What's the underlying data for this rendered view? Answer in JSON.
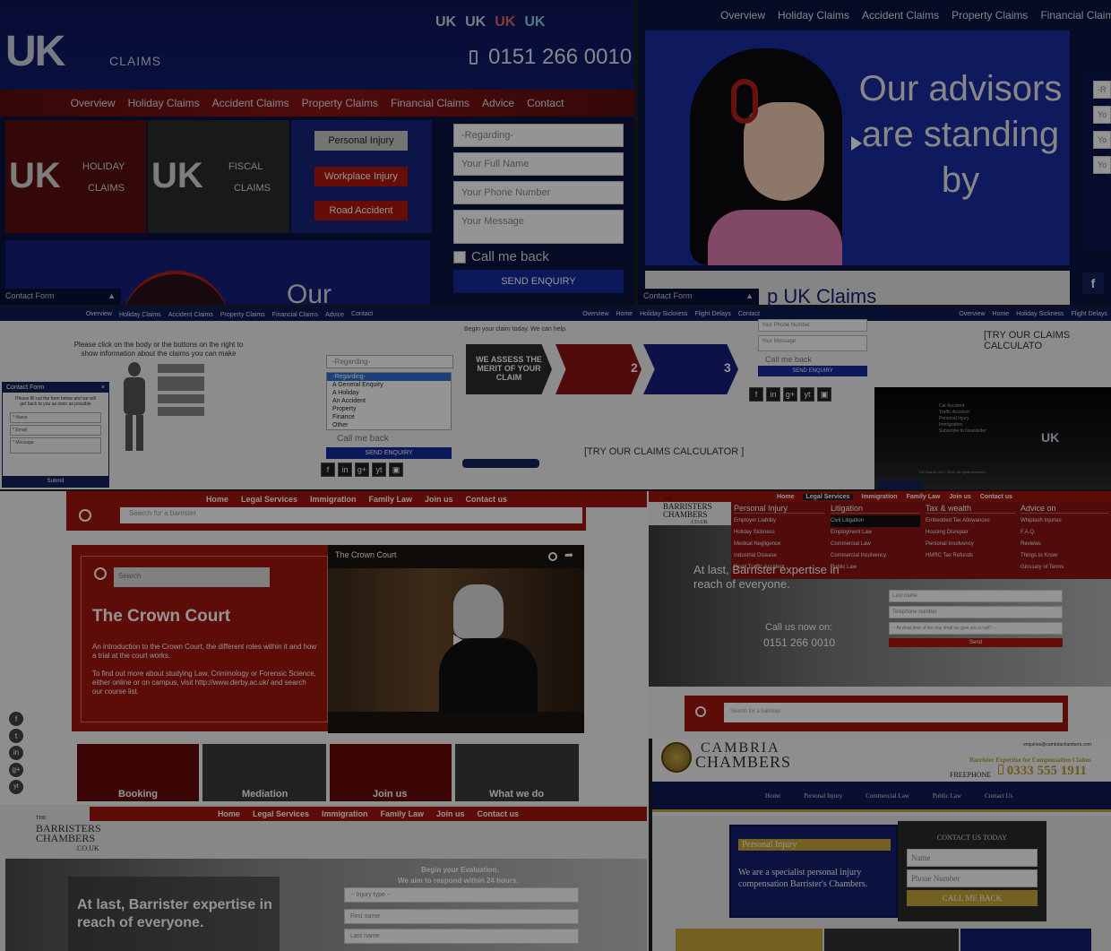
{
  "uk1": {
    "logo_main": "UK",
    "logo_sub": "CLAIMS",
    "strip": [
      "UK",
      "UK",
      "UK",
      "UK"
    ],
    "phone": "0151 266 0010",
    "nav": [
      "Overview",
      "Holiday Claims",
      "Accident Claims",
      "Property Claims",
      "Financial Claims",
      "Advice",
      "Contact"
    ],
    "tile_holiday_sub": "HOLIDAY",
    "tile_fiscal_sub": "FISCAL",
    "buttons": [
      "Personal Injury",
      "Workplace Injury",
      "Road Accident"
    ],
    "form": {
      "regarding": "-Regarding-",
      "name": "Your Full Name",
      "phone": "Your Phone Number",
      "message": "Your Message",
      "callback": "Call me back",
      "send": "SEND ENQUIRY"
    },
    "contact_form": "Contact Form",
    "peek_text": "Our"
  },
  "uk2": {
    "nav": [
      "Overview",
      "Holiday Claims",
      "Accident Claims",
      "Property Claims",
      "Financial Claims"
    ],
    "hero_text": "Our advisors are standing by",
    "contact_form": "Contact Form",
    "welcome": "p UK Claims",
    "side_inputs": [
      "-R",
      "Yo",
      "Yo",
      "Yo"
    ]
  },
  "row2": {
    "nav": [
      "Overview",
      "Holiday Claims",
      "Accident Claims",
      "Property Claims",
      "Financial Claims",
      "Advice",
      "Contact"
    ],
    "body_text": "Please click on the body or the buttons on the right to show information about the claims you can make",
    "contact_form": "Contact Form",
    "cf_text": "Please fill out the form below and we will get back to you as soon as possible",
    "cf_fields": [
      "* Name",
      "* Email",
      "* Message"
    ],
    "cf_submit": "Submit",
    "dropdown_head": "-Regarding-",
    "dropdown_options": [
      "-Regarding-",
      "A General Enquiry",
      "A Holiday",
      "An Accident",
      "Property",
      "Finance",
      "Other"
    ],
    "callback": "Call me back",
    "send": "SEND ENQUIRY",
    "nav3": [
      "Overview",
      "Home",
      "Holiday Sickness",
      "Flight Delays",
      "Contact"
    ],
    "begin": "Begin your claim today. We can help.",
    "steps": [
      "WE ASSESS THE MERIT OF YOUR CLAIM",
      "2",
      "3"
    ],
    "mini_inputs": [
      "Your Phone Number",
      "Your Message"
    ],
    "calc": "[TRY OUR CLAIMS CALCULATOR ]",
    "nav4": [
      "Overview",
      "Home",
      "Holiday Sickness",
      "Flight Delays"
    ],
    "calc2": "[TRY OUR CLAIMS CALCULATO",
    "list4": [
      "Car Accident",
      "Traffic Accident",
      "Personal Injury",
      "Immigration",
      "Subscribe to Newsletter"
    ],
    "footer4": "UK Claims Ltd © 2016. All rights reserved."
  },
  "barr1": {
    "nav": [
      "Home",
      "Legal Services",
      "Immigration",
      "Family Law",
      "Join us",
      "Contact us"
    ],
    "search_top": "Search for a barrister",
    "search": "Search",
    "title": "The Crown Court",
    "p1": "An introduction to the Crown Court, the different roles within it and how a trial at the court works.",
    "p2": "To find out more about studying Law, Criminology or Forensic Science, either online or on campus, visit http://www.derby.ac.uk/ and search our course list.",
    "video_title": "The Crown Court",
    "tiles": [
      "Booking",
      "Mediation",
      "Join us",
      "What we do"
    ]
  },
  "barr2": {
    "nav": [
      "Home",
      "Legal Services",
      "Immigration",
      "Family Law",
      "Join us",
      "Contact us"
    ],
    "logo": [
      "THE",
      "BARRISTERS",
      "CHAMBERS",
      ".CO.UK"
    ],
    "cols": [
      {
        "head": "Personal Injury",
        "items": [
          "Employer Liability",
          "Holiday Sickness",
          "Medical Negligence",
          "Industrial Disease",
          "Road Traffic Accident"
        ]
      },
      {
        "head": "Litigation",
        "items": [
          "Civil Litigation",
          "Employment Law",
          "Commercial Law",
          "Commercial Insolvency",
          "Public Law"
        ]
      },
      {
        "head": "Tax & wealth",
        "items": [
          "Embedded Tax Allowances",
          "Housing Disrepair",
          "Personal Insolvency",
          "HMRC Tax Refunds"
        ]
      },
      {
        "head": "Advice on",
        "items": [
          "Whiplash Injuries",
          "F.A.Q.",
          "Reviews",
          "Things to Know",
          "Glossary of Terms"
        ]
      }
    ],
    "hero": "At last, Barrister expertise in reach of everyone.",
    "call": "Call us now on:",
    "phone": "0151 266 0010",
    "fields": [
      "Last name",
      "Telephone number",
      "-- At what time of the day shall we give you a call? --"
    ],
    "send": "Send",
    "search": "Search for a barrister"
  },
  "cambria": {
    "name1": "CAMBRIA",
    "name2": "CHAMBERS",
    "email": "enquiries@cambriachambers.com",
    "tagline": "Barrister Expertise for Compensation Claims",
    "freephone": "FREEPHONE",
    "phone": "0333 555 1911",
    "nav": [
      "Home",
      "Personal Injury",
      "Commercial Law",
      "Public Law",
      "Contact Us"
    ],
    "pi_title": "Personal Injury",
    "pi_text": "We are a specialist personal injury compensation Barrister's Chambers.",
    "contact_title": "CONTACT US TODAY",
    "inputs": [
      "Name",
      "Phone Number"
    ],
    "callback": "CALL ME BACK"
  },
  "barr3": {
    "nav": [
      "Home",
      "Legal Services",
      "Immigration",
      "Family Law",
      "Join us",
      "Contact us"
    ],
    "logo": [
      "THE",
      "BARRISTERS",
      "CHAMBERS",
      ".CO.UK"
    ],
    "begin": "Begin your Evaluation.",
    "respond": "We aim to respond within 24 hours.",
    "injury": "-- Injury type --",
    "first": "First name",
    "last": "Last name",
    "hero": "At last, Barrister expertise in reach of everyone."
  },
  "social_icons": [
    "f",
    "t",
    "in",
    "g+",
    "yt"
  ],
  "colors": {
    "navy": "#101a55",
    "red": "#b2170f",
    "dark": "#0c0c0c"
  }
}
